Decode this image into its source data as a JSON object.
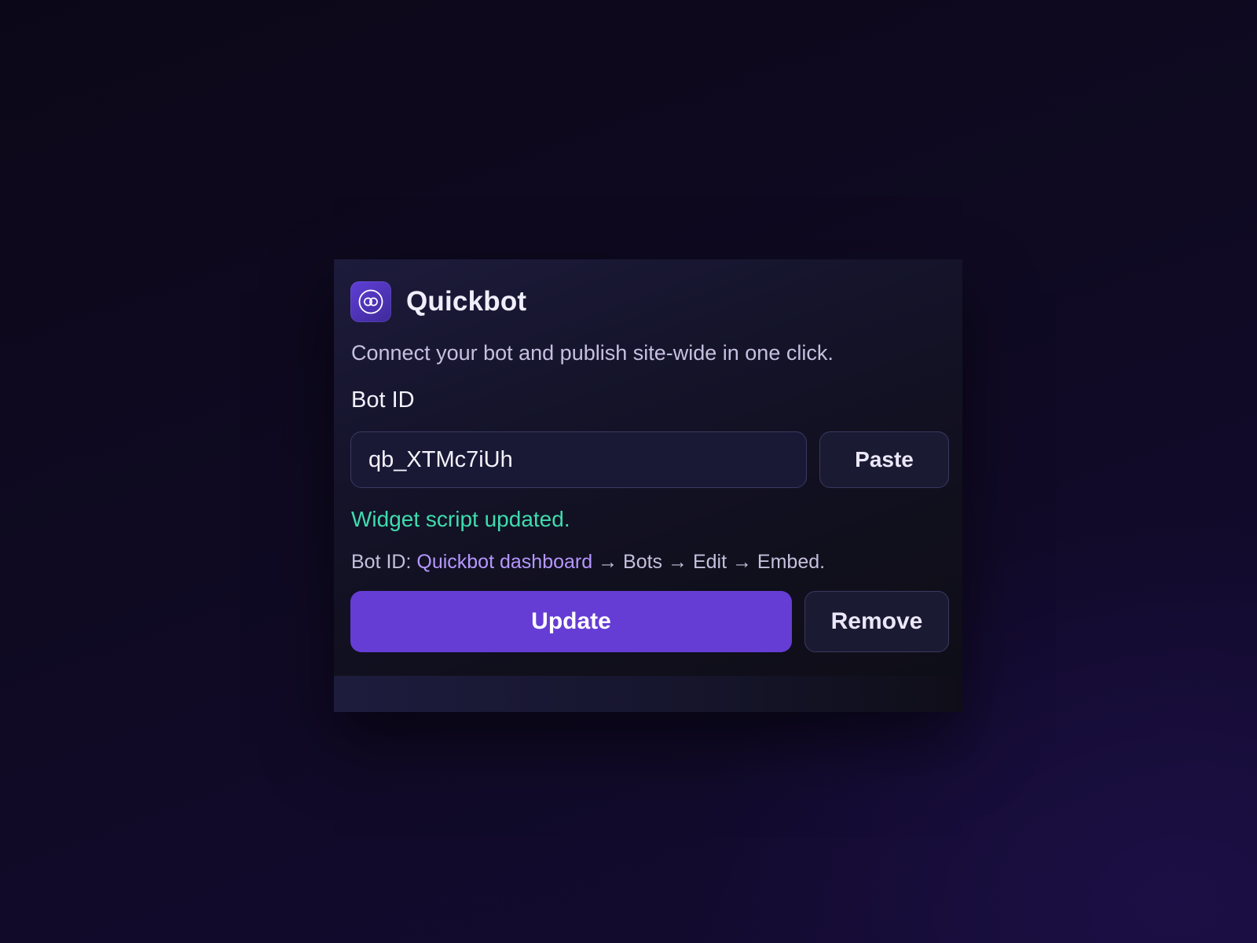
{
  "app": {
    "title": "Quickbot",
    "subtitle": "Connect your bot and publish site-wide in one click.",
    "logo_icon": "quickbot-logo-icon"
  },
  "form": {
    "bot_id_label": "Bot ID",
    "bot_id_value": "qb_XTMc7iUh",
    "paste_label": "Paste"
  },
  "status": {
    "message": "Widget script updated.",
    "color": "#3fdcae"
  },
  "help": {
    "prefix": "Bot ID: ",
    "link_text": "Quickbot dashboard",
    "suffix": " → Bots → Edit → Embed."
  },
  "actions": {
    "update_label": "Update",
    "remove_label": "Remove"
  },
  "colors": {
    "accent": "#653dd4",
    "link": "#b597ff",
    "success": "#3fdcae"
  }
}
